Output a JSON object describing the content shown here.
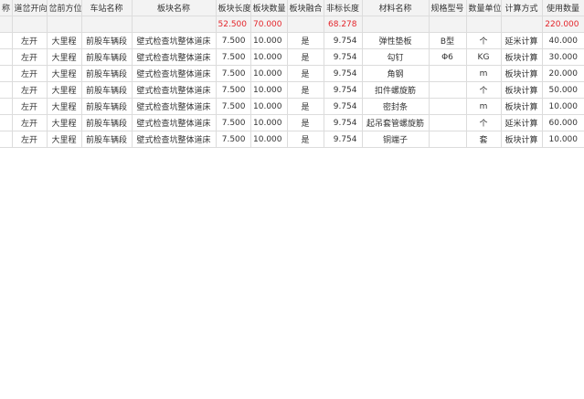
{
  "columns": [
    "称",
    "道岔开向",
    "岔前方位",
    "车站名称",
    "板块名称",
    "板块长度",
    "板块数量",
    "板块融合",
    "非标长度",
    "材料名称",
    "规格型号",
    "数量单位",
    "计算方式",
    "使用数量"
  ],
  "summary": {
    "block_length": "52.500",
    "block_count": "70.000",
    "nonstd_length": "68.278",
    "usage_qty": "220.000"
  },
  "rows": [
    {
      "turnout_dir": "左开",
      "front_dir": "大里程",
      "station": "前股车辆段",
      "block_name": "壁式检查坑整体道床",
      "block_length": "7.500",
      "block_count": "10.000",
      "block_merge": "是",
      "nonstd_length": "9.754",
      "material": "弹性垫板",
      "spec": "B型",
      "unit": "个",
      "calc_method": "延米计算",
      "usage_qty": "40.000"
    },
    {
      "turnout_dir": "左开",
      "front_dir": "大里程",
      "station": "前股车辆段",
      "block_name": "壁式检查坑整体道床",
      "block_length": "7.500",
      "block_count": "10.000",
      "block_merge": "是",
      "nonstd_length": "9.754",
      "material": "勾钉",
      "spec": "Φ6",
      "unit": "KG",
      "calc_method": "板块计算",
      "usage_qty": "30.000"
    },
    {
      "turnout_dir": "左开",
      "front_dir": "大里程",
      "station": "前股车辆段",
      "block_name": "壁式检查坑整体道床",
      "block_length": "7.500",
      "block_count": "10.000",
      "block_merge": "是",
      "nonstd_length": "9.754",
      "material": "角钢",
      "spec": "",
      "unit": "m",
      "calc_method": "板块计算",
      "usage_qty": "20.000"
    },
    {
      "turnout_dir": "左开",
      "front_dir": "大里程",
      "station": "前股车辆段",
      "block_name": "壁式检查坑整体道床",
      "block_length": "7.500",
      "block_count": "10.000",
      "block_merge": "是",
      "nonstd_length": "9.754",
      "material": "扣件螺旋筋",
      "spec": "",
      "unit": "个",
      "calc_method": "板块计算",
      "usage_qty": "50.000"
    },
    {
      "turnout_dir": "左开",
      "front_dir": "大里程",
      "station": "前股车辆段",
      "block_name": "壁式检查坑整体道床",
      "block_length": "7.500",
      "block_count": "10.000",
      "block_merge": "是",
      "nonstd_length": "9.754",
      "material": "密封条",
      "spec": "",
      "unit": "m",
      "calc_method": "板块计算",
      "usage_qty": "10.000"
    },
    {
      "turnout_dir": "左开",
      "front_dir": "大里程",
      "station": "前股车辆段",
      "block_name": "壁式检查坑整体道床",
      "block_length": "7.500",
      "block_count": "10.000",
      "block_merge": "是",
      "nonstd_length": "9.754",
      "material": "起吊套管螺旋筋",
      "spec": "",
      "unit": "个",
      "calc_method": "延米计算",
      "usage_qty": "60.000"
    },
    {
      "turnout_dir": "左开",
      "front_dir": "大里程",
      "station": "前股车辆段",
      "block_name": "壁式检查坑整体道床",
      "block_length": "7.500",
      "block_count": "10.000",
      "block_merge": "是",
      "nonstd_length": "9.754",
      "material": "铜端子",
      "spec": "",
      "unit": "套",
      "calc_method": "板块计算",
      "usage_qty": "10.000"
    }
  ],
  "colors": {
    "header_bg": "#f3f3f3",
    "grid_line": "#dcdcdc",
    "summary_text": "#e4252b"
  }
}
